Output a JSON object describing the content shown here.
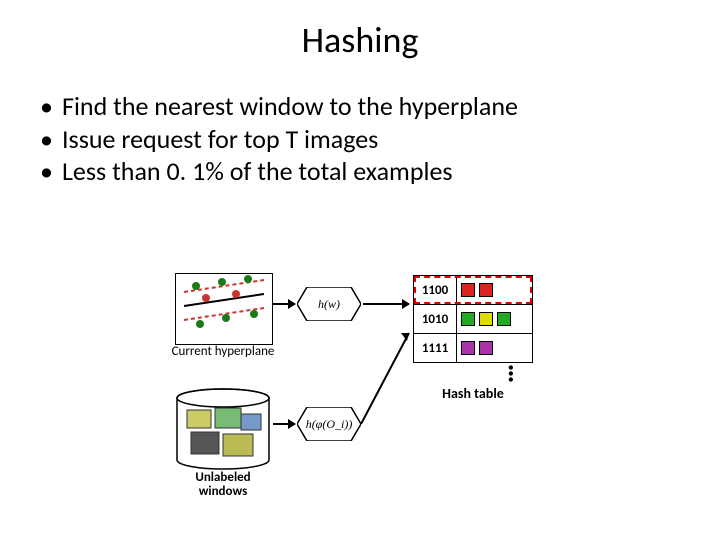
{
  "title": "Hashing",
  "bullets": [
    "Find the nearest window to the hyperplane",
    "Issue request for top T images",
    "Less than 0. 1% of the total examples"
  ],
  "diagram": {
    "hyperplane_label": "Current hyperplane",
    "unlabeled_label": "Unlabeled windows",
    "hash_fn_w": "h(w)",
    "hash_fn_phi": "h(φ(O_i))",
    "table_label": "Hash table",
    "rows": [
      {
        "code": "1100",
        "colors": [
          "#d22",
          "#d22"
        ],
        "highlight": true
      },
      {
        "code": "1010",
        "colors": [
          "#2a2",
          "#dd0",
          "#2a2"
        ],
        "highlight": false
      },
      {
        "code": "1111",
        "colors": [
          "#a3a",
          "#a3a"
        ],
        "highlight": false
      }
    ]
  }
}
